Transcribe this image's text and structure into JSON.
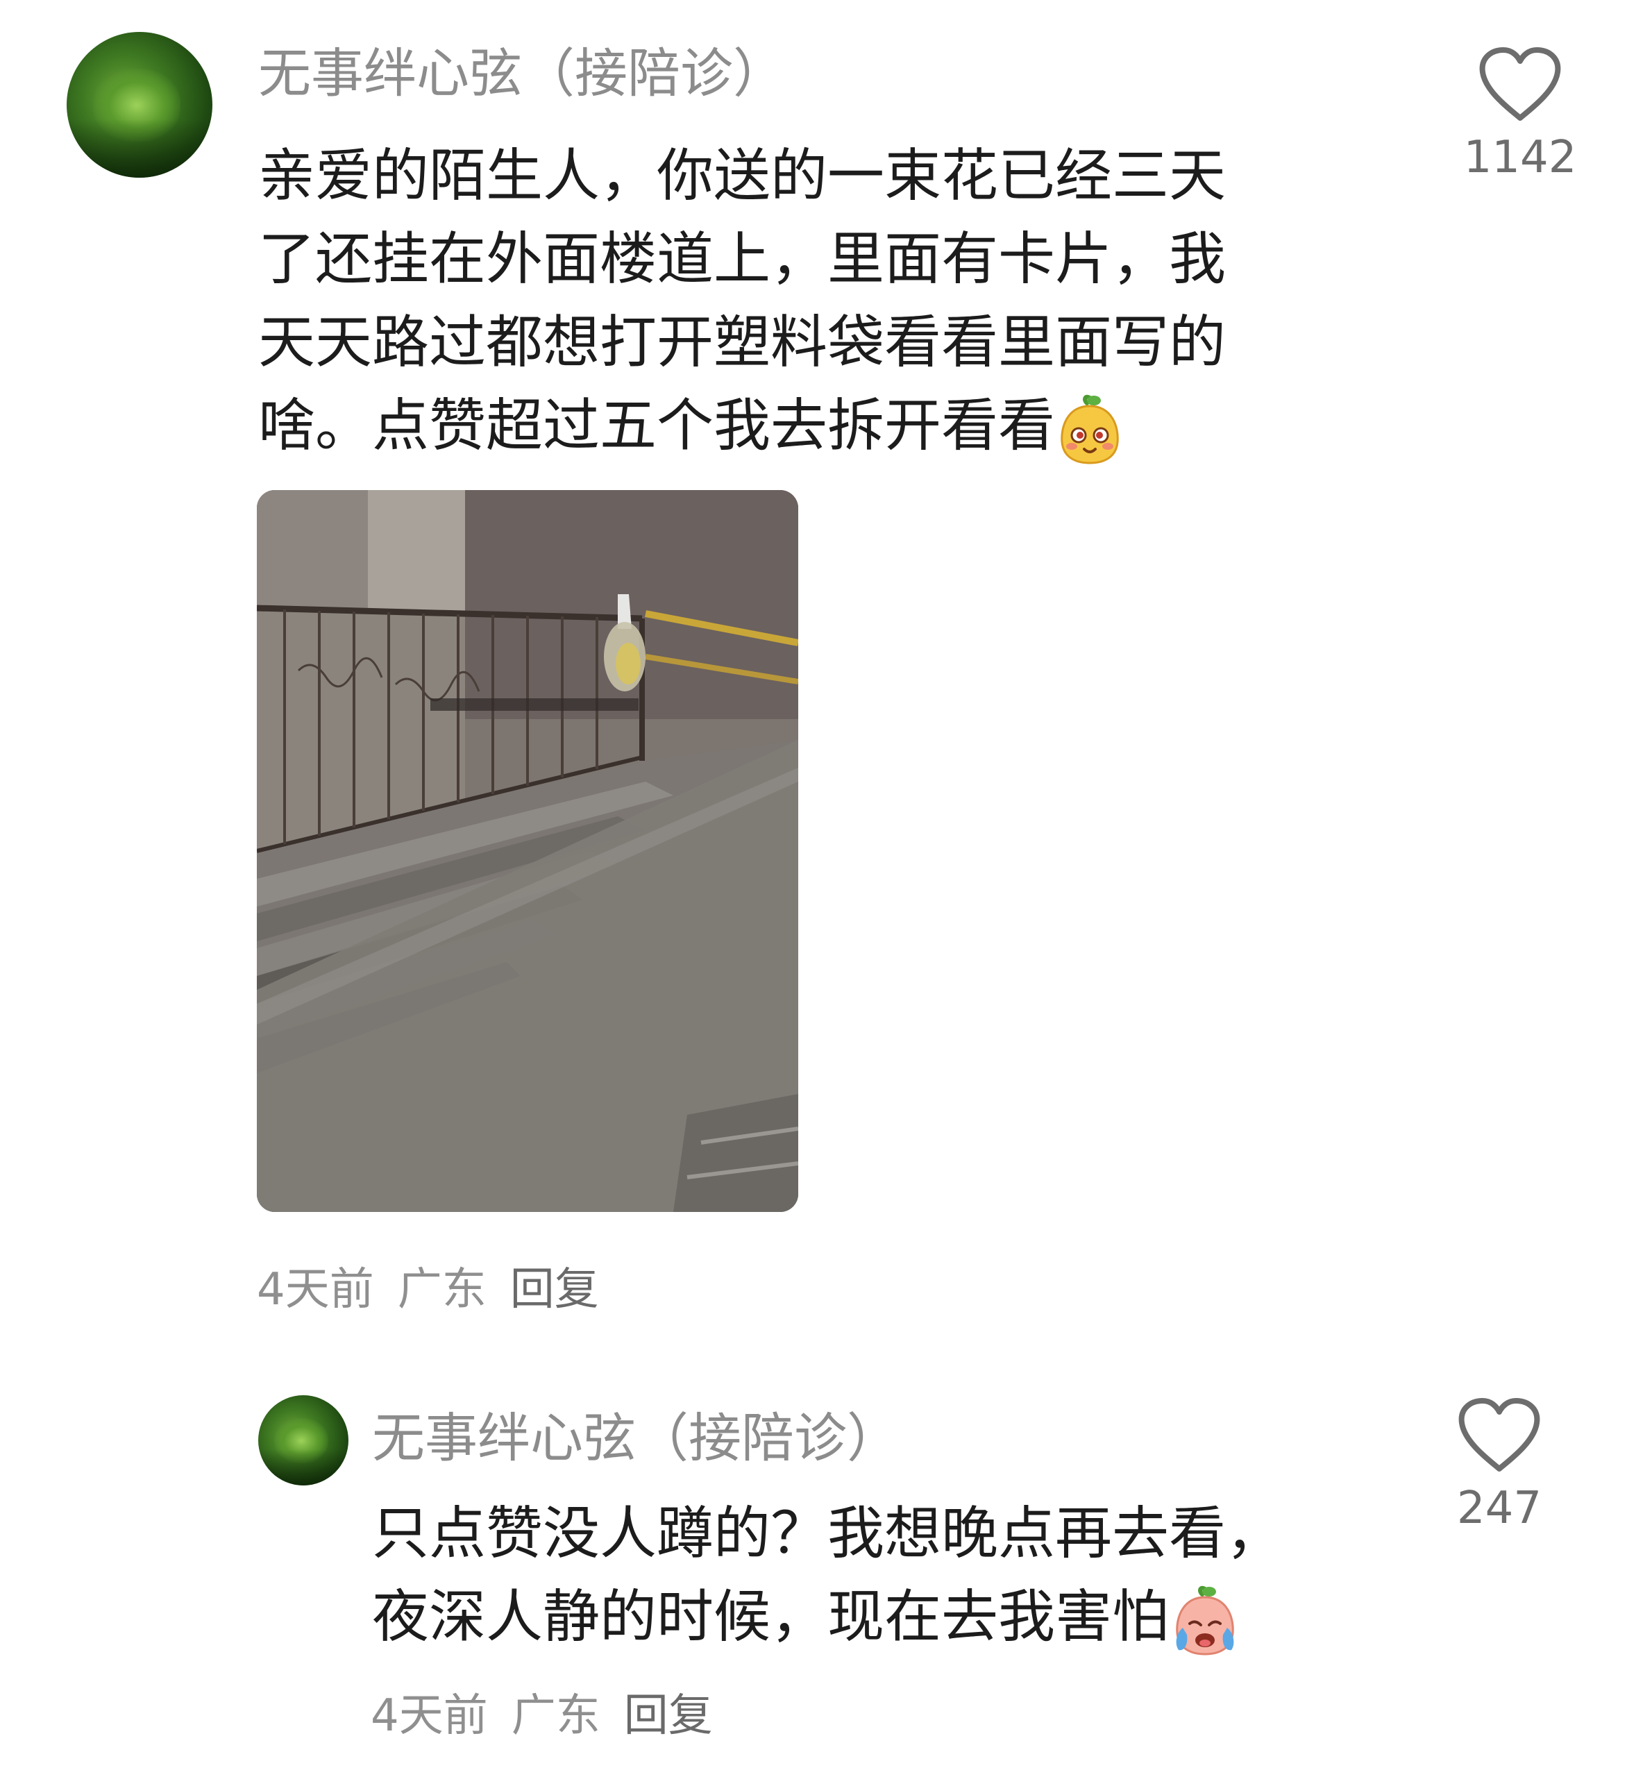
{
  "comments": [
    {
      "username": "无事绊心弦（接陪诊）",
      "text_lines": [
        "亲爱的陌生人，你送的一束花已经三天",
        "了还挂在外面楼道上，里面有卡片，我",
        "天天路过都想打开塑料袋看看里面写的",
        "啥。点赞超过五个我去拆开看看"
      ],
      "emoji": "shy-mascot-emoji",
      "like_count": "1142",
      "time": "4天前",
      "location": "广东",
      "reply_label": "回复",
      "image_icon": "stairwell-photo"
    },
    {
      "username": "无事绊心弦（接陪诊）",
      "text_lines": [
        "只点赞没人蹲的？我想晚点再去看，",
        "夜深人静的时候，现在去我害怕"
      ],
      "emoji": "crying-mascot-emoji",
      "like_count": "247",
      "time": "4天前",
      "location": "广东",
      "reply_label": "回复"
    }
  ],
  "colors": {
    "username": "#8c8c8c",
    "text": "#1c1c1c",
    "meta": "#8f8f8f",
    "like_icon": "#6d6d6d"
  }
}
